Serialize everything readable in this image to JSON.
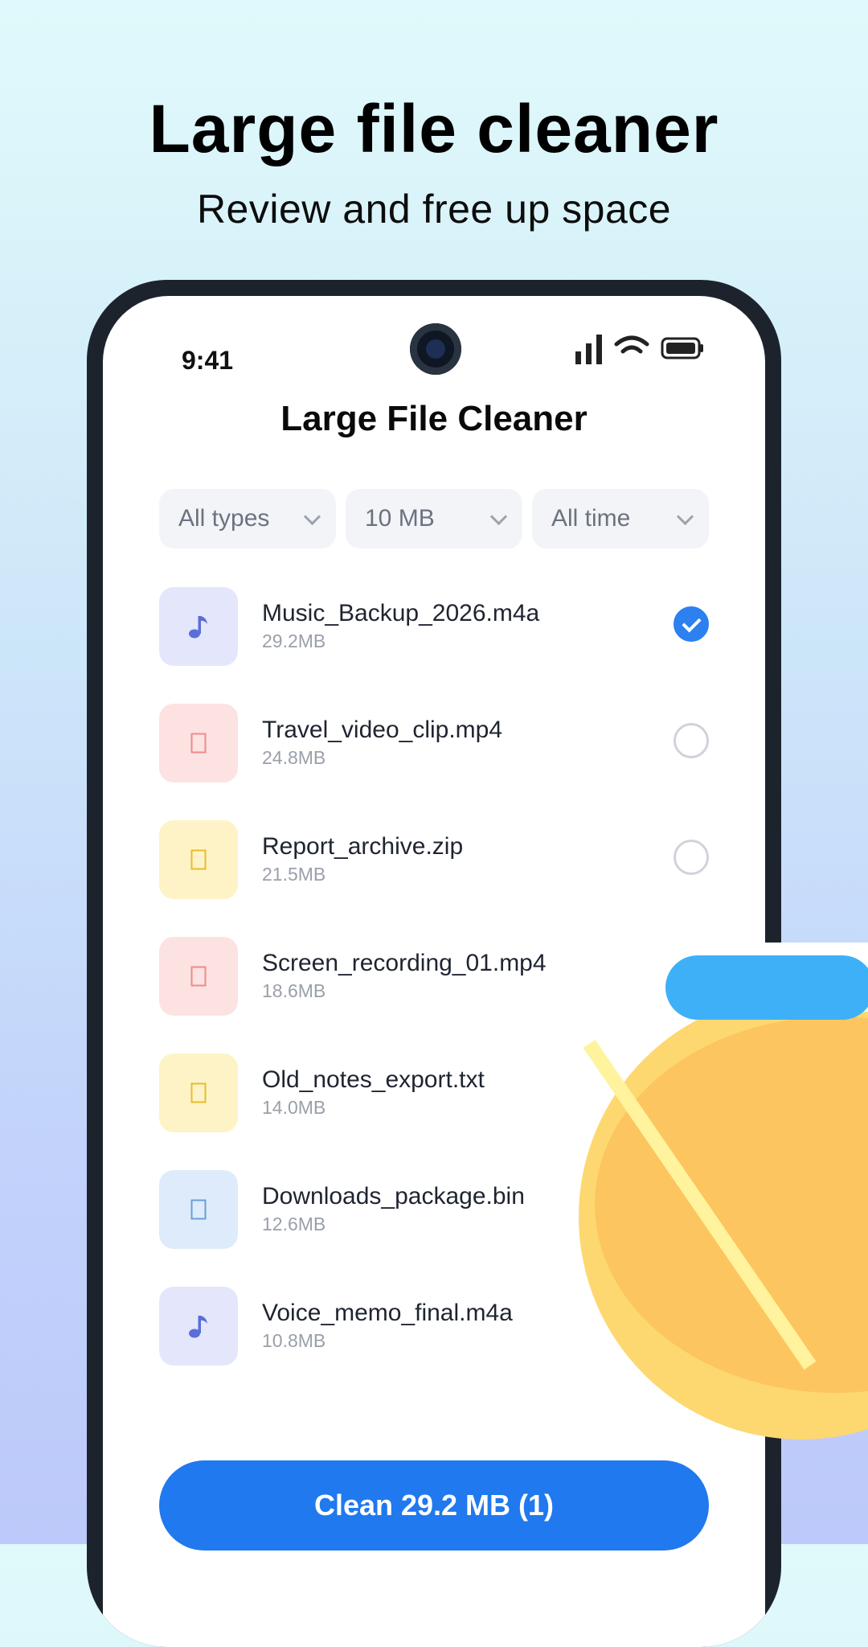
{
  "hero": {
    "title": "Large file cleaner",
    "subtitle": "Review and free up space"
  },
  "status_bar": {
    "time": "9:41",
    "icons": [
      "signal-icon",
      "wifi-icon",
      "battery-icon"
    ]
  },
  "app": {
    "title": "Large File Cleaner"
  },
  "filters": [
    {
      "label": "All types",
      "icon": "chevron-down-icon"
    },
    {
      "label": "10 MB",
      "icon": "chevron-down-icon"
    },
    {
      "label": "All time",
      "icon": "chevron-down-icon"
    }
  ],
  "files": [
    {
      "name": "Music_Backup_2026.m4a",
      "size": "29.2MB",
      "type": "audio",
      "icon": "music-note-icon",
      "selected": true
    },
    {
      "name": "Travel_video_clip.mp4",
      "size": "24.8MB",
      "type": "video",
      "icon": "video-icon",
      "selected": false
    },
    {
      "name": "Report_archive.zip",
      "size": "21.5MB",
      "type": "archive",
      "icon": "archive-icon",
      "selected": false
    },
    {
      "name": "Screen_recording_01.mp4",
      "size": "18.6MB",
      "type": "video",
      "icon": "video-icon",
      "selected": false
    },
    {
      "name": "Old_notes_export.txt",
      "size": "14.0MB",
      "type": "document",
      "icon": "document-icon",
      "selected": false
    },
    {
      "name": "Downloads_package.bin",
      "size": "12.6MB",
      "type": "other",
      "icon": "file-icon",
      "selected": false
    },
    {
      "name": "Voice_memo_final.m4a",
      "size": "10.8MB",
      "type": "audio",
      "icon": "music-note-icon",
      "selected": false
    }
  ],
  "action": {
    "clean_label": "Clean 29.2 MB (1)"
  },
  "colors": {
    "accent": "#2079ee",
    "checked": "#2c80f0",
    "audio_bg": "#e4e7fc",
    "audio_fg": "#5a6fd6",
    "video_bg": "#fde2e2",
    "video_fg": "#f08a8a",
    "archive_bg": "#fdf3c6",
    "archive_fg": "#e9bb2c",
    "document_bg": "#fdf3c6",
    "document_fg": "#e9bb2c",
    "other_bg": "#deebfb",
    "other_fg": "#6a9fd6"
  }
}
